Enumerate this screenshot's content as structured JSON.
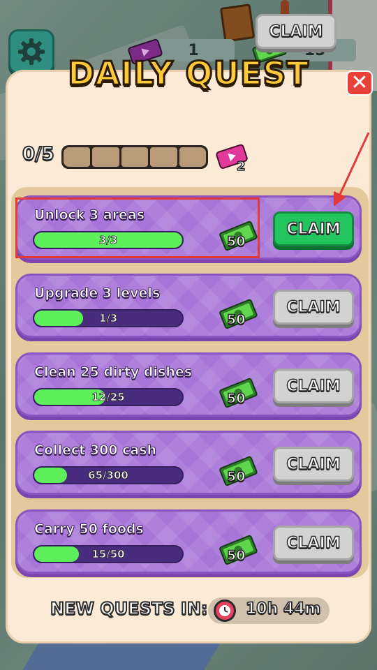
{
  "hud": {
    "tickets": "1",
    "cash": "15",
    "settings_icon": "gear-icon"
  },
  "panel": {
    "title": "DAILY QUEST",
    "close_icon": "close-icon",
    "close_glyph": "✕"
  },
  "progress": {
    "count_text": "0/5",
    "completed_segments": 0,
    "total_segments": 5,
    "reward_ticket_qty": "2",
    "claim_label": "CLAIM"
  },
  "quests": [
    {
      "title": "Unlock 3 areas",
      "progress_text": "3/3",
      "progress": 1.0,
      "reward": "50",
      "claim_label": "CLAIM",
      "claimable": true
    },
    {
      "title": "Upgrade 3 levels",
      "progress_text": "1/3",
      "progress": 0.333,
      "reward": "50",
      "claim_label": "CLAIM",
      "claimable": false
    },
    {
      "title": "Clean 25 dirty dishes",
      "progress_text": "12/25",
      "progress": 0.48,
      "reward": "50",
      "claim_label": "CLAIM",
      "claimable": false
    },
    {
      "title": "Collect 300 cash",
      "progress_text": "65/300",
      "progress": 0.217,
      "reward": "50",
      "claim_label": "CLAIM",
      "claimable": false
    },
    {
      "title": "Carry 50 foods",
      "progress_text": "15/50",
      "progress": 0.3,
      "reward": "50",
      "claim_label": "CLAIM",
      "claimable": false
    }
  ],
  "footer": {
    "label": "NEW QUESTS IN:",
    "timer": "10h 44m",
    "timer_icon": "clock-icon"
  },
  "colors": {
    "accent_green": "#22c55e",
    "quest_purple": "#a775d8",
    "progress_green": "#5ef05a",
    "highlight_red": "#e23a3a"
  }
}
